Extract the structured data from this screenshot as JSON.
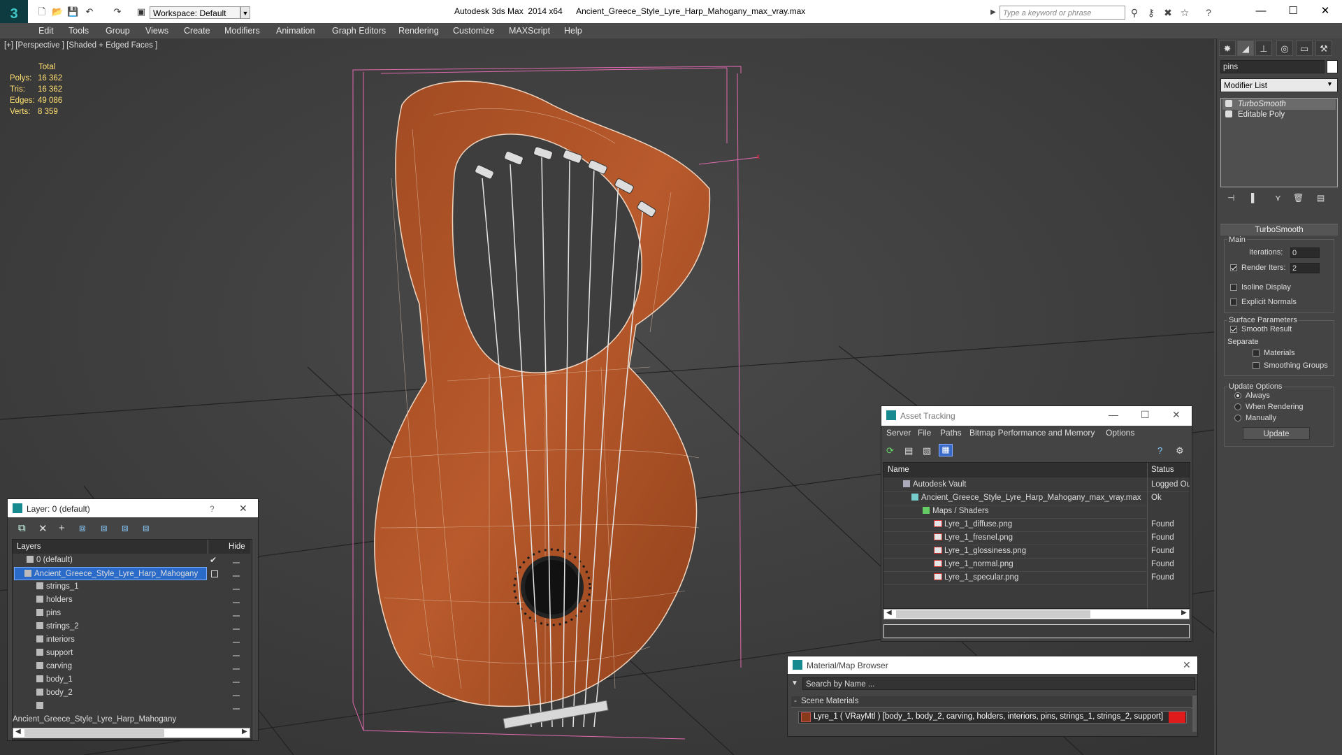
{
  "app": {
    "title": "Autodesk 3ds Max  2014 x64      Ancient_Greece_Style_Lyre_Harp_Mahogany_max_vray.max",
    "workspace": "Workspace: Default",
    "search_placeholder": "Type a keyword or phrase",
    "window_controls": [
      "—",
      "☐",
      "✕"
    ]
  },
  "menu": [
    "Edit",
    "Tools",
    "Group",
    "Views",
    "Create",
    "Modifiers",
    "Animation",
    "Graph Editors",
    "Rendering",
    "Customize",
    "MAXScript",
    "Help"
  ],
  "viewport": {
    "label": "[+] [Perspective ] [Shaded + Edged Faces ]",
    "stats": {
      "header": "Total",
      "rows": [
        {
          "label": "Polys:",
          "value": "16 362"
        },
        {
          "label": "Tris:",
          "value": "16 362"
        },
        {
          "label": "Edges:",
          "value": "49 086"
        },
        {
          "label": "Verts:",
          "value": "8 359"
        }
      ]
    }
  },
  "command_panel": {
    "object_name": "pins",
    "modifier_list": "Modifier List",
    "stack": [
      "TurboSmooth",
      "Editable Poly"
    ],
    "rollout": "TurboSmooth",
    "main": {
      "title": "Main",
      "iterations_label": "Iterations:",
      "iterations": "0",
      "render_iters_label": "Render Iters:",
      "render_iters": "2",
      "isoline_label": "Isoline Display",
      "explicit_label": "Explicit Normals"
    },
    "surface": {
      "title": "Surface Parameters",
      "smooth_label": "Smooth Result",
      "separate_label": "Separate",
      "materials_label": "Materials",
      "smoothing_label": "Smoothing Groups"
    },
    "update": {
      "title": "Update Options",
      "always": "Always",
      "when_rendering": "When Rendering",
      "manually": "Manually",
      "button": "Update"
    }
  },
  "layer_panel": {
    "title": "Layer: 0 (default)",
    "help": "?",
    "close": "✕",
    "col_layers": "Layers",
    "col_hide": "Hide",
    "rows": [
      {
        "name": "0 (default)",
        "indent": 1
      },
      {
        "name": "Ancient_Greece_Style_Lyre_Harp_Mahogany",
        "indent": 1,
        "selected": true
      },
      {
        "name": "strings_1",
        "indent": 2
      },
      {
        "name": "holders",
        "indent": 2
      },
      {
        "name": "pins",
        "indent": 2
      },
      {
        "name": "strings_2",
        "indent": 2
      },
      {
        "name": "interiors",
        "indent": 2
      },
      {
        "name": "support",
        "indent": 2
      },
      {
        "name": "carving",
        "indent": 2
      },
      {
        "name": "body_1",
        "indent": 2
      },
      {
        "name": "body_2",
        "indent": 2
      },
      {
        "name": "Ancient_Greece_Style_Lyre_Harp_Mahogany",
        "indent": 2
      }
    ]
  },
  "asset_tracking": {
    "title": "Asset Tracking",
    "menu": [
      "Server",
      "File",
      "Paths",
      "Bitmap Performance and Memory",
      "Options"
    ],
    "col_name": "Name",
    "col_status": "Status",
    "rows": [
      {
        "name": "Autodesk Vault",
        "status": "Logged Ou",
        "indent": 1,
        "icon": "vault"
      },
      {
        "name": "Ancient_Greece_Style_Lyre_Harp_Mahogany_max_vray.max",
        "status": "Ok",
        "indent": 2,
        "icon": "max"
      },
      {
        "name": "Maps / Shaders",
        "status": "",
        "indent": 3,
        "icon": "maps"
      },
      {
        "name": "Lyre_1_diffuse.png",
        "status": "Found",
        "indent": 4,
        "icon": "png"
      },
      {
        "name": "Lyre_1_fresnel.png",
        "status": "Found",
        "indent": 4,
        "icon": "png"
      },
      {
        "name": "Lyre_1_glossiness.png",
        "status": "Found",
        "indent": 4,
        "icon": "png"
      },
      {
        "name": "Lyre_1_normal.png",
        "status": "Found",
        "indent": 4,
        "icon": "png"
      },
      {
        "name": "Lyre_1_specular.png",
        "status": "Found",
        "indent": 4,
        "icon": "png"
      }
    ]
  },
  "material_browser": {
    "title": "Material/Map Browser",
    "close": "✕",
    "search_placeholder": "Search by Name ...",
    "section": "Scene Materials",
    "item": "Lyre_1  ( VRayMtl )  [body_1, body_2, carving, holders, interiors, pins, strings_1, strings_2, support]"
  }
}
